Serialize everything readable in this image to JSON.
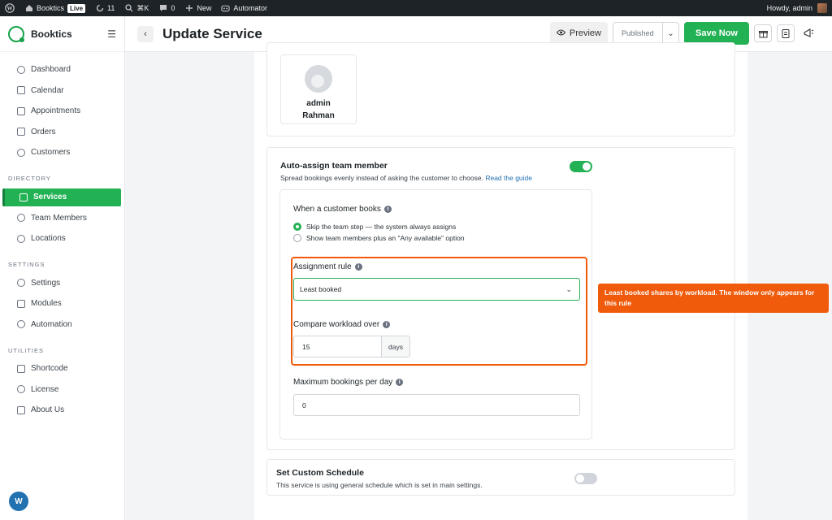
{
  "adminbar": {
    "site_name": "Booktics",
    "live_badge": "Live",
    "updates_count": "11",
    "search_shortcut": "⌘K",
    "comments_count": "0",
    "new_label": "New",
    "automator_label": "Automator",
    "greeting": "Howdy, admin"
  },
  "sidebar": {
    "brand": "Booktics",
    "items_top": [
      {
        "label": "Dashboard"
      },
      {
        "label": "Calendar"
      },
      {
        "label": "Appointments"
      },
      {
        "label": "Orders"
      },
      {
        "label": "Customers"
      }
    ],
    "section_directory": "DIRECTORY",
    "items_directory": [
      {
        "label": "Services"
      },
      {
        "label": "Team Members"
      },
      {
        "label": "Locations"
      }
    ],
    "section_settings": "SETTINGS",
    "items_settings": [
      {
        "label": "Settings"
      },
      {
        "label": "Modules"
      },
      {
        "label": "Automation"
      }
    ],
    "section_utilities": "UTILITIES",
    "items_utilities": [
      {
        "label": "Shortcode"
      },
      {
        "label": "License"
      },
      {
        "label": "About Us"
      }
    ],
    "wp_logo": "W"
  },
  "header": {
    "title": "Update Service",
    "preview_label": "Preview",
    "status_value": "Published",
    "save_label": "Save Now"
  },
  "team_member": {
    "first_name": "admin",
    "last_name": "Rahman"
  },
  "auto_assign": {
    "title": "Auto-assign team member",
    "description": "Spread bookings evenly instead of asking the customer to choose.",
    "guide_link": "Read the guide",
    "enabled": true,
    "when_label": "When a customer books",
    "options": [
      {
        "label": "Skip the team step — the system always assigns",
        "checked": true
      },
      {
        "label": "Show team members plus an \"Any available\" option",
        "checked": false
      }
    ],
    "rule_label": "Assignment rule",
    "rule_value": "Least booked",
    "compare_label": "Compare workload over",
    "compare_value": "15",
    "compare_unit": "days",
    "max_label": "Maximum bookings per day",
    "max_value": "0"
  },
  "callout": {
    "text": "Least booked shares by workload. The window only appears for this rule"
  },
  "schedule": {
    "title": "Set Custom Schedule",
    "description": "This service is using general schedule which is set in main settings.",
    "enabled": false
  },
  "colors": {
    "accent": "#22b254",
    "highlight": "#f05a0b",
    "adminbar": "#1d2327"
  }
}
